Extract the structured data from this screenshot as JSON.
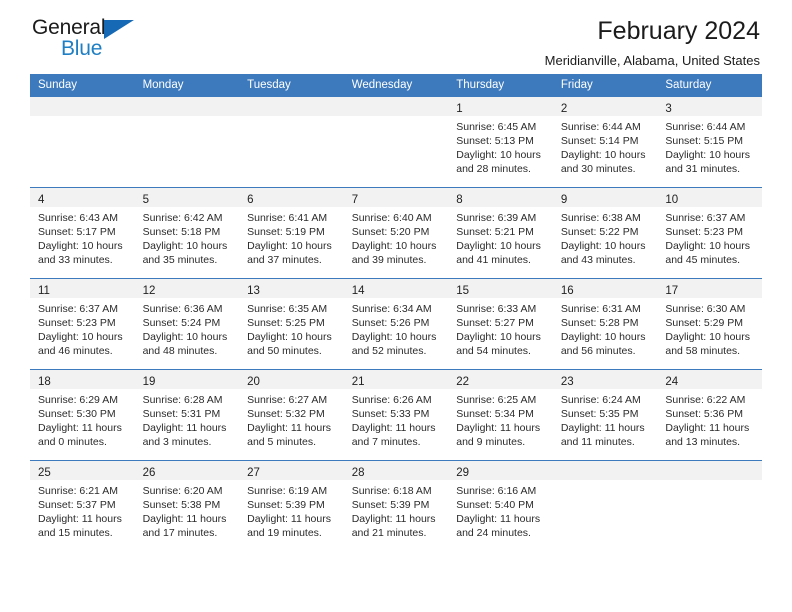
{
  "brand": {
    "name_top": "General",
    "name_bottom": "Blue",
    "triangle_color": "#1669b4",
    "blue_text_color": "#1f7fc4"
  },
  "header": {
    "title": "February 2024",
    "subtitle": "Meridianville, Alabama, United States"
  },
  "theme": {
    "header_blue": "#3c79bd",
    "row_shade": "#f2f2f2",
    "text": "#222222"
  },
  "calendar": {
    "weekday_headers": [
      "Sunday",
      "Monday",
      "Tuesday",
      "Wednesday",
      "Thursday",
      "Friday",
      "Saturday"
    ],
    "labels": {
      "sunrise": "Sunrise:",
      "sunset": "Sunset:",
      "daylight": "Daylight:"
    },
    "weeks": [
      [
        {
          "day": "",
          "sunrise": "",
          "sunset": "",
          "daylight_1": "",
          "daylight_2": ""
        },
        {
          "day": "",
          "sunrise": "",
          "sunset": "",
          "daylight_1": "",
          "daylight_2": ""
        },
        {
          "day": "",
          "sunrise": "",
          "sunset": "",
          "daylight_1": "",
          "daylight_2": ""
        },
        {
          "day": "",
          "sunrise": "",
          "sunset": "",
          "daylight_1": "",
          "daylight_2": ""
        },
        {
          "day": "1",
          "sunrise": "Sunrise: 6:45 AM",
          "sunset": "Sunset: 5:13 PM",
          "daylight_1": "Daylight: 10 hours",
          "daylight_2": "and 28 minutes."
        },
        {
          "day": "2",
          "sunrise": "Sunrise: 6:44 AM",
          "sunset": "Sunset: 5:14 PM",
          "daylight_1": "Daylight: 10 hours",
          "daylight_2": "and 30 minutes."
        },
        {
          "day": "3",
          "sunrise": "Sunrise: 6:44 AM",
          "sunset": "Sunset: 5:15 PM",
          "daylight_1": "Daylight: 10 hours",
          "daylight_2": "and 31 minutes."
        }
      ],
      [
        {
          "day": "4",
          "sunrise": "Sunrise: 6:43 AM",
          "sunset": "Sunset: 5:17 PM",
          "daylight_1": "Daylight: 10 hours",
          "daylight_2": "and 33 minutes."
        },
        {
          "day": "5",
          "sunrise": "Sunrise: 6:42 AM",
          "sunset": "Sunset: 5:18 PM",
          "daylight_1": "Daylight: 10 hours",
          "daylight_2": "and 35 minutes."
        },
        {
          "day": "6",
          "sunrise": "Sunrise: 6:41 AM",
          "sunset": "Sunset: 5:19 PM",
          "daylight_1": "Daylight: 10 hours",
          "daylight_2": "and 37 minutes."
        },
        {
          "day": "7",
          "sunrise": "Sunrise: 6:40 AM",
          "sunset": "Sunset: 5:20 PM",
          "daylight_1": "Daylight: 10 hours",
          "daylight_2": "and 39 minutes."
        },
        {
          "day": "8",
          "sunrise": "Sunrise: 6:39 AM",
          "sunset": "Sunset: 5:21 PM",
          "daylight_1": "Daylight: 10 hours",
          "daylight_2": "and 41 minutes."
        },
        {
          "day": "9",
          "sunrise": "Sunrise: 6:38 AM",
          "sunset": "Sunset: 5:22 PM",
          "daylight_1": "Daylight: 10 hours",
          "daylight_2": "and 43 minutes."
        },
        {
          "day": "10",
          "sunrise": "Sunrise: 6:37 AM",
          "sunset": "Sunset: 5:23 PM",
          "daylight_1": "Daylight: 10 hours",
          "daylight_2": "and 45 minutes."
        }
      ],
      [
        {
          "day": "11",
          "sunrise": "Sunrise: 6:37 AM",
          "sunset": "Sunset: 5:23 PM",
          "daylight_1": "Daylight: 10 hours",
          "daylight_2": "and 46 minutes."
        },
        {
          "day": "12",
          "sunrise": "Sunrise: 6:36 AM",
          "sunset": "Sunset: 5:24 PM",
          "daylight_1": "Daylight: 10 hours",
          "daylight_2": "and 48 minutes."
        },
        {
          "day": "13",
          "sunrise": "Sunrise: 6:35 AM",
          "sunset": "Sunset: 5:25 PM",
          "daylight_1": "Daylight: 10 hours",
          "daylight_2": "and 50 minutes."
        },
        {
          "day": "14",
          "sunrise": "Sunrise: 6:34 AM",
          "sunset": "Sunset: 5:26 PM",
          "daylight_1": "Daylight: 10 hours",
          "daylight_2": "and 52 minutes."
        },
        {
          "day": "15",
          "sunrise": "Sunrise: 6:33 AM",
          "sunset": "Sunset: 5:27 PM",
          "daylight_1": "Daylight: 10 hours",
          "daylight_2": "and 54 minutes."
        },
        {
          "day": "16",
          "sunrise": "Sunrise: 6:31 AM",
          "sunset": "Sunset: 5:28 PM",
          "daylight_1": "Daylight: 10 hours",
          "daylight_2": "and 56 minutes."
        },
        {
          "day": "17",
          "sunrise": "Sunrise: 6:30 AM",
          "sunset": "Sunset: 5:29 PM",
          "daylight_1": "Daylight: 10 hours",
          "daylight_2": "and 58 minutes."
        }
      ],
      [
        {
          "day": "18",
          "sunrise": "Sunrise: 6:29 AM",
          "sunset": "Sunset: 5:30 PM",
          "daylight_1": "Daylight: 11 hours",
          "daylight_2": "and 0 minutes."
        },
        {
          "day": "19",
          "sunrise": "Sunrise: 6:28 AM",
          "sunset": "Sunset: 5:31 PM",
          "daylight_1": "Daylight: 11 hours",
          "daylight_2": "and 3 minutes."
        },
        {
          "day": "20",
          "sunrise": "Sunrise: 6:27 AM",
          "sunset": "Sunset: 5:32 PM",
          "daylight_1": "Daylight: 11 hours",
          "daylight_2": "and 5 minutes."
        },
        {
          "day": "21",
          "sunrise": "Sunrise: 6:26 AM",
          "sunset": "Sunset: 5:33 PM",
          "daylight_1": "Daylight: 11 hours",
          "daylight_2": "and 7 minutes."
        },
        {
          "day": "22",
          "sunrise": "Sunrise: 6:25 AM",
          "sunset": "Sunset: 5:34 PM",
          "daylight_1": "Daylight: 11 hours",
          "daylight_2": "and 9 minutes."
        },
        {
          "day": "23",
          "sunrise": "Sunrise: 6:24 AM",
          "sunset": "Sunset: 5:35 PM",
          "daylight_1": "Daylight: 11 hours",
          "daylight_2": "and 11 minutes."
        },
        {
          "day": "24",
          "sunrise": "Sunrise: 6:22 AM",
          "sunset": "Sunset: 5:36 PM",
          "daylight_1": "Daylight: 11 hours",
          "daylight_2": "and 13 minutes."
        }
      ],
      [
        {
          "day": "25",
          "sunrise": "Sunrise: 6:21 AM",
          "sunset": "Sunset: 5:37 PM",
          "daylight_1": "Daylight: 11 hours",
          "daylight_2": "and 15 minutes."
        },
        {
          "day": "26",
          "sunrise": "Sunrise: 6:20 AM",
          "sunset": "Sunset: 5:38 PM",
          "daylight_1": "Daylight: 11 hours",
          "daylight_2": "and 17 minutes."
        },
        {
          "day": "27",
          "sunrise": "Sunrise: 6:19 AM",
          "sunset": "Sunset: 5:39 PM",
          "daylight_1": "Daylight: 11 hours",
          "daylight_2": "and 19 minutes."
        },
        {
          "day": "28",
          "sunrise": "Sunrise: 6:18 AM",
          "sunset": "Sunset: 5:39 PM",
          "daylight_1": "Daylight: 11 hours",
          "daylight_2": "and 21 minutes."
        },
        {
          "day": "29",
          "sunrise": "Sunrise: 6:16 AM",
          "sunset": "Sunset: 5:40 PM",
          "daylight_1": "Daylight: 11 hours",
          "daylight_2": "and 24 minutes."
        },
        {
          "day": "",
          "sunrise": "",
          "sunset": "",
          "daylight_1": "",
          "daylight_2": ""
        },
        {
          "day": "",
          "sunrise": "",
          "sunset": "",
          "daylight_1": "",
          "daylight_2": ""
        }
      ]
    ]
  }
}
